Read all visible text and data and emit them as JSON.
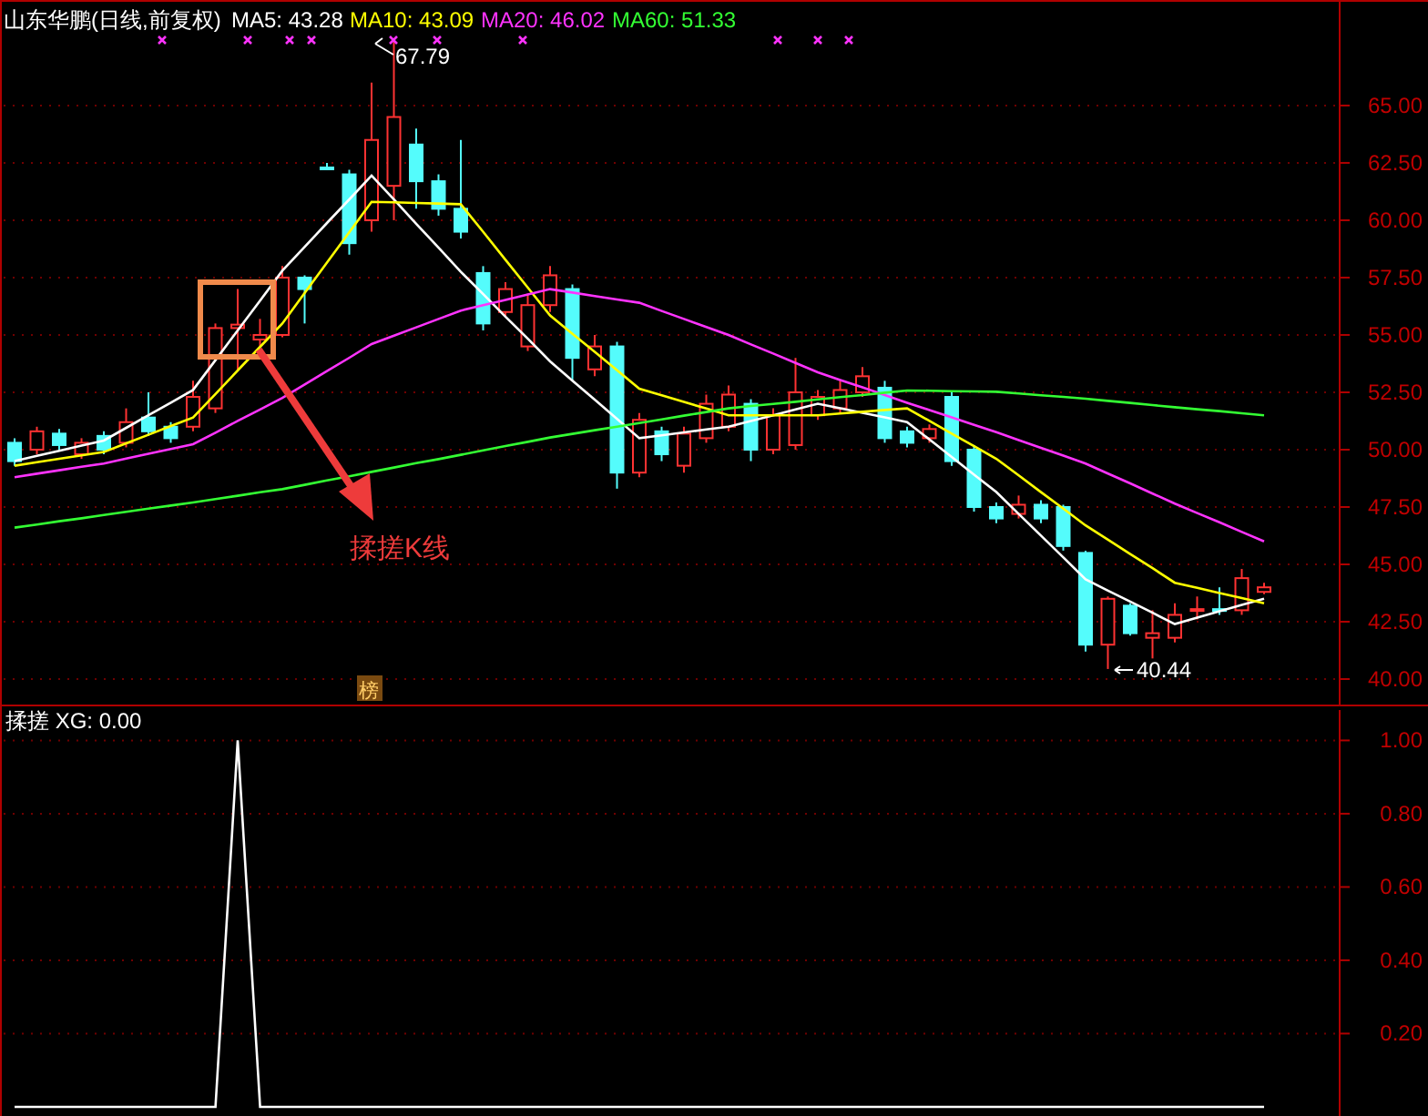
{
  "header": {
    "title": "山东华鹏(日线,前复权)",
    "legend": [
      {
        "label": "MA5: 43.28",
        "color": "#ffffff"
      },
      {
        "label": "MA10: 43.09",
        "color": "#ffff00"
      },
      {
        "label": "MA20: 46.02",
        "color": "#ff33ff"
      },
      {
        "label": "MA60: 51.33",
        "color": "#33ff33"
      }
    ]
  },
  "price_chart": {
    "high_label": "67.79",
    "low_label": "40.44",
    "annotation": "揉搓K线",
    "badge": "榜",
    "chart_data": {
      "type": "candlestick",
      "categories": [
        null,
        null,
        null,
        null,
        null,
        null,
        null,
        null,
        null,
        null,
        null,
        null,
        null,
        null,
        null,
        null,
        null,
        null,
        null,
        null,
        null,
        null,
        null,
        null,
        null,
        null,
        null,
        null,
        null,
        null,
        null,
        null,
        null,
        null,
        null,
        null,
        null,
        null,
        null,
        null,
        null,
        null,
        null,
        null,
        null,
        null,
        null,
        null,
        null,
        null,
        null,
        null,
        null,
        null,
        null,
        null,
        null
      ],
      "ylim": [
        38.85,
        69.6
      ],
      "grid": true,
      "yticks": [
        {
          "value": 65,
          "label": "65.00"
        },
        {
          "value": 62.5,
          "label": "62.50"
        },
        {
          "value": 60,
          "label": "60.00"
        },
        {
          "value": 57.5,
          "label": "57.50"
        },
        {
          "value": 55,
          "label": "55.00"
        },
        {
          "value": 52.5,
          "label": "52.50"
        },
        {
          "value": 50,
          "label": "50.00"
        },
        {
          "value": 47.5,
          "label": "47.50"
        },
        {
          "value": 45,
          "label": "45.00"
        },
        {
          "value": 42.5,
          "label": "42.50"
        },
        {
          "value": 40,
          "label": "40.00"
        }
      ],
      "ohlc": [
        [
          50.3,
          50.5,
          49.3,
          49.5
        ],
        [
          50.0,
          51.0,
          49.8,
          50.8
        ],
        [
          50.7,
          50.9,
          50.0,
          50.2
        ],
        [
          49.8,
          50.5,
          49.6,
          50.3
        ],
        [
          50.6,
          50.8,
          49.8,
          50.0
        ],
        [
          50.3,
          51.8,
          50.1,
          51.2
        ],
        [
          51.4,
          52.5,
          50.6,
          50.8
        ],
        [
          51.0,
          51.2,
          50.3,
          50.5
        ],
        [
          51.0,
          53.0,
          50.8,
          52.3
        ],
        [
          51.8,
          55.5,
          51.6,
          55.3
        ],
        [
          55.3,
          57.0,
          53.5,
          55.45
        ],
        [
          54.8,
          55.7,
          54.5,
          55.0
        ],
        [
          55.0,
          58.0,
          54.9,
          57.5
        ],
        [
          57.5,
          57.6,
          55.5,
          57.0
        ],
        [
          62.3,
          62.5,
          62.2,
          62.25
        ],
        [
          62.0,
          62.2,
          58.5,
          59.0
        ],
        [
          60.0,
          66.0,
          59.5,
          63.5
        ],
        [
          61.5,
          67.79,
          60.0,
          64.5
        ],
        [
          63.3,
          64.0,
          60.5,
          61.7
        ],
        [
          61.7,
          62.0,
          60.2,
          60.5
        ],
        [
          60.5,
          63.5,
          59.2,
          59.5
        ],
        [
          57.7,
          58.0,
          55.2,
          55.5
        ],
        [
          56.0,
          57.3,
          55.8,
          57.0
        ],
        [
          54.5,
          56.8,
          54.3,
          56.3
        ],
        [
          56.3,
          58.0,
          56.0,
          57.6
        ],
        [
          57.0,
          57.2,
          53.0,
          54.0
        ],
        [
          53.5,
          55.0,
          53.2,
          54.5
        ],
        [
          54.5,
          54.7,
          48.3,
          49.0
        ],
        [
          49.0,
          51.6,
          48.8,
          51.3
        ],
        [
          50.8,
          51.0,
          49.5,
          49.8
        ],
        [
          49.3,
          51.0,
          49.0,
          50.7
        ],
        [
          50.5,
          52.4,
          50.3,
          52.0
        ],
        [
          51.0,
          52.8,
          50.8,
          52.4
        ],
        [
          52.0,
          52.2,
          49.5,
          50.0
        ],
        [
          50.0,
          51.8,
          49.8,
          51.5
        ],
        [
          50.2,
          54.0,
          50.0,
          52.5
        ],
        [
          51.5,
          52.6,
          51.3,
          52.3
        ],
        [
          51.8,
          53.0,
          51.6,
          52.6
        ],
        [
          52.5,
          53.6,
          52.3,
          53.2
        ],
        [
          52.7,
          53.0,
          50.3,
          50.5
        ],
        [
          50.8,
          51.0,
          50.1,
          50.3
        ],
        [
          50.5,
          51.1,
          50.3,
          50.9
        ],
        [
          52.3,
          52.5,
          49.3,
          49.5
        ],
        [
          50.0,
          50.2,
          47.3,
          47.5
        ],
        [
          47.5,
          47.7,
          46.8,
          47.0
        ],
        [
          47.2,
          48.0,
          47.0,
          47.6
        ],
        [
          47.6,
          47.8,
          46.8,
          47.0
        ],
        [
          47.5,
          47.6,
          45.6,
          45.8
        ],
        [
          45.5,
          45.6,
          41.2,
          41.5
        ],
        [
          41.5,
          43.6,
          40.44,
          43.5
        ],
        [
          43.2,
          43.3,
          41.9,
          42.0
        ],
        [
          41.8,
          43.0,
          40.9,
          42.0
        ],
        [
          41.8,
          43.3,
          41.6,
          42.8
        ],
        [
          43.0,
          43.6,
          42.6,
          43.05
        ],
        [
          43.05,
          44.0,
          42.8,
          43.0
        ],
        [
          43.0,
          44.8,
          42.8,
          44.4
        ],
        [
          43.8,
          44.2,
          43.7,
          44.0
        ]
      ]
    }
  },
  "moving_averages": {
    "chart_data": {
      "type": "line",
      "categories": [
        null,
        null,
        null,
        null,
        null,
        null,
        null,
        null,
        null,
        null,
        null,
        null,
        null,
        null,
        null,
        null,
        null,
        null,
        null,
        null,
        null,
        null,
        null,
        null,
        null,
        null,
        null,
        null,
        null,
        null,
        null,
        null,
        null,
        null,
        null,
        null,
        null,
        null,
        null,
        null,
        null,
        null,
        null,
        null,
        null,
        null,
        null,
        null,
        null,
        null,
        null,
        null,
        null,
        null,
        null,
        null,
        null
      ],
      "ylim": [
        38.85,
        69.6
      ],
      "series": [
        {
          "color": "#ffffff",
          "values": [
            49.5,
            49.73,
            49.95,
            50.18,
            50.4,
            50.95,
            51.5,
            52.05,
            52.6,
            53.9,
            55.2,
            56.5,
            57.8,
            58.84,
            59.88,
            60.91,
            61.95,
            60.9,
            59.85,
            58.8,
            57.75,
            56.78,
            55.8,
            54.83,
            53.85,
            53.01,
            52.18,
            51.34,
            50.5,
            50.63,
            50.75,
            50.88,
            51.0,
            51.25,
            51.5,
            51.75,
            52.0,
            51.8,
            51.6,
            51.4,
            51.2,
            50.44,
            49.68,
            48.91,
            48.15,
            47.2,
            46.25,
            45.3,
            44.35,
            43.86,
            43.38,
            42.89,
            42.4,
            42.68,
            42.95,
            43.23,
            43.5
          ]
        },
        {
          "color": "#ffff00",
          "values": [
            49.3,
            49.45,
            49.6,
            49.75,
            49.9,
            50.28,
            50.65,
            51.03,
            51.4,
            52.43,
            53.45,
            54.48,
            55.5,
            56.83,
            58.15,
            59.48,
            60.8,
            60.78,
            60.75,
            60.73,
            60.7,
            59.49,
            58.28,
            57.06,
            55.85,
            55.05,
            54.26,
            53.46,
            52.66,
            52.37,
            52.08,
            51.79,
            51.5,
            51.5,
            51.5,
            51.5,
            51.5,
            51.58,
            51.65,
            51.73,
            51.8,
            51.25,
            50.7,
            50.15,
            49.6,
            48.88,
            48.15,
            47.43,
            46.7,
            46.08,
            45.45,
            44.83,
            44.2,
            43.98,
            43.75,
            43.53,
            43.3
          ]
        },
        {
          "color": "#ff33ff",
          "values": [
            48.8,
            48.95,
            49.1,
            49.25,
            49.4,
            49.61,
            49.82,
            50.03,
            50.24,
            50.74,
            51.25,
            51.75,
            52.25,
            52.84,
            53.43,
            54.01,
            54.6,
            54.97,
            55.33,
            55.7,
            56.06,
            56.3,
            56.53,
            56.77,
            57.0,
            56.85,
            56.7,
            56.55,
            56.4,
            56.05,
            55.7,
            55.35,
            55.0,
            54.59,
            54.19,
            53.78,
            53.37,
            53.04,
            52.71,
            52.38,
            52.05,
            51.73,
            51.41,
            51.08,
            50.76,
            50.42,
            50.08,
            49.74,
            49.4,
            48.96,
            48.53,
            48.09,
            47.65,
            47.24,
            46.83,
            46.41,
            46.0
          ]
        },
        {
          "color": "#33ff33",
          "values": [
            46.6,
            46.74,
            46.88,
            47.01,
            47.15,
            47.29,
            47.43,
            47.56,
            47.7,
            47.85,
            47.99,
            48.14,
            48.28,
            48.47,
            48.66,
            48.84,
            49.03,
            49.22,
            49.41,
            49.59,
            49.78,
            49.97,
            50.16,
            50.34,
            50.53,
            50.69,
            50.85,
            51.0,
            51.16,
            51.32,
            51.48,
            51.64,
            51.8,
            51.9,
            51.99,
            52.09,
            52.19,
            52.29,
            52.38,
            52.48,
            52.58,
            52.57,
            52.55,
            52.54,
            52.52,
            52.45,
            52.37,
            52.3,
            52.22,
            52.13,
            52.04,
            51.94,
            51.85,
            51.76,
            51.68,
            51.59,
            51.5
          ]
        }
      ]
    }
  },
  "indicator": {
    "title": "揉搓 XG: 0.00",
    "chart_data": {
      "type": "line",
      "categories": [
        null,
        null,
        null,
        null,
        null,
        null,
        null,
        null,
        null,
        null,
        null,
        null,
        null,
        null,
        null,
        null,
        null,
        null,
        null,
        null,
        null,
        null,
        null,
        null,
        null,
        null,
        null,
        null,
        null,
        null,
        null,
        null,
        null,
        null,
        null,
        null,
        null,
        null,
        null,
        null,
        null,
        null,
        null,
        null,
        null,
        null,
        null,
        null,
        null,
        null,
        null,
        null,
        null,
        null,
        null,
        null,
        null
      ],
      "ylim": [
        -0.025,
        1.083
      ],
      "grid": true,
      "yticks": [
        {
          "value": 0.2,
          "label": "0.20"
        },
        {
          "value": 0.4,
          "label": "0.40"
        },
        {
          "value": 0.6,
          "label": "0.60"
        },
        {
          "value": 0.8,
          "label": "0.80"
        },
        {
          "value": 1.0,
          "label": "1.00"
        }
      ],
      "series": [
        {
          "color": "#ffffff",
          "values": [
            0,
            0,
            0,
            0,
            0,
            0,
            0,
            0,
            0,
            0,
            1,
            0,
            0,
            0,
            0,
            0,
            0,
            0,
            0,
            0,
            0,
            0,
            0,
            0,
            0,
            0,
            0,
            0,
            0,
            0,
            0,
            0,
            0,
            0,
            0,
            0,
            0,
            0,
            0,
            0,
            0,
            0,
            0,
            0,
            0,
            0,
            0,
            0,
            0,
            0,
            0,
            0,
            0,
            0,
            0,
            0,
            0
          ]
        }
      ]
    }
  }
}
